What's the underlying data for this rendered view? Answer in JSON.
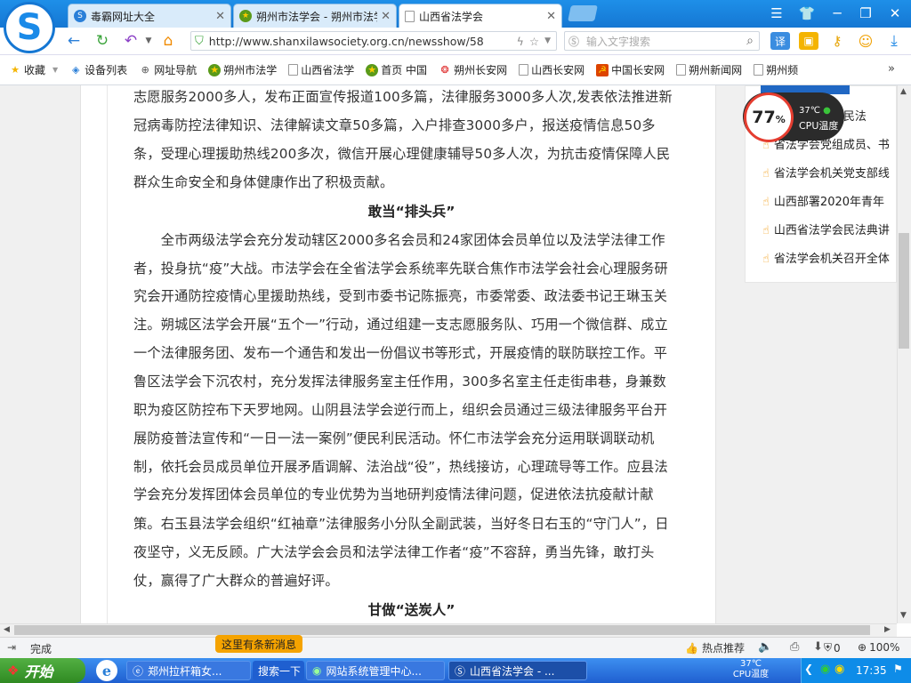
{
  "browser": {
    "tabs": [
      {
        "label": "毒霸网址大全",
        "fav_color": "#2a7fd8"
      },
      {
        "label": "朔州市法学会 - 朔州市法学",
        "fav_color": "#5a9a1a"
      },
      {
        "label": "山西省法学会",
        "fav_color": "#ffffff"
      }
    ],
    "url": "http://www.shanxilawsociety.org.cn/newsshow/58",
    "search_placeholder": "输入文字搜索"
  },
  "bookmarks": [
    {
      "label": "收藏",
      "icon": "star-icon"
    },
    {
      "label": "设备列表",
      "icon": "device-icon"
    },
    {
      "label": "网址导航",
      "icon": "globe-icon"
    },
    {
      "label": "朔州市法学",
      "icon": "emblem-icon"
    },
    {
      "label": "山西省法学",
      "icon": "page-icon"
    },
    {
      "label": "首页 中国",
      "icon": "emblem-icon"
    },
    {
      "label": "朔州长安网",
      "icon": "red-logo-icon"
    },
    {
      "label": "山西长安网",
      "icon": "page-icon"
    },
    {
      "label": "中国长安网",
      "icon": "party-icon"
    },
    {
      "label": "朔州新闻网",
      "icon": "page-icon"
    },
    {
      "label": "朔州频",
      "icon": "page-icon"
    }
  ],
  "article": {
    "lines_top": [
      "志愿服务2000多人，发布正面宣传报道100多篇，法律服务3000多人次,发表依法推进新",
      "冠病毒防控法律知识、法律解读文章50多篇，入户排查3000多户，报送疫情信息50多",
      "条，受理心理援助热线200多次，微信开展心理健康辅导50多人次，为抗击疫情保障人民",
      "群众生命安全和身体健康作出了积极贡献。"
    ],
    "heading1": "敢当“排头兵”",
    "lines_mid": [
      "　　全市两级法学会充分发动辖区2000多名会员和24家团体会员单位以及法学法律工作",
      "者，投身抗“疫”大战。市法学会在全省法学会系统率先联合焦作市法学会社会心理服务研",
      "究会开通防控疫情心里援助热线，受到市委书记陈振亮，市委常委、政法委书记王琳玉关",
      "注。朔城区法学会开展“五个一”行动，通过组建一支志愿服务队、巧用一个微信群、成立",
      "一个法律服务团、发布一个通告和发出一份倡议书等形式，开展疫情的联防联控工作。平",
      "鲁区法学会下沉农村，充分发挥法律服务室主任作用，300多名室主任走街串巷，身兼数",
      "职为疫区防控布下天罗地网。山阴县法学会逆行而上，组织会员通过三级法律服务平台开",
      "展防疫普法宣传和“一日一法一案例”便民利民活动。怀仁市法学会充分运用联调联动机",
      "制，依托会员成员单位开展矛盾调解、法治战“役”，热线接访，心理疏导等工作。应县法",
      "学会充分发挥团体会员单位的专业优势为当地研判疫情法律问题，促进依法抗疫献计献",
      "策。右玉县法学会组织“红袖章”法律服务小分队全副武装，当好冬日右玉的“守门人”，日",
      "夜坚守，义无反顾。广大法学会会员和法学法律工作者“疫”不容辞，勇当先锋，敢打头",
      "仗，赢得了广大群众的普遍好评。"
    ],
    "heading2": "甘做“送炭人”"
  },
  "sidebar": {
    "items": [
      "省法学会组织民法",
      "省法学会党组成员、书",
      "省法学会机关党支部线",
      "山西部署2020年青年",
      "山西省法学会民法典讲",
      "省法学会机关召开全体"
    ]
  },
  "cpu_widget": {
    "percent": "77",
    "unit": "%",
    "temp": "37℃",
    "label": "CPU温度"
  },
  "statusbar": {
    "status": "完成",
    "new_msg": "这里有条新消息",
    "hot": "热点推荐",
    "count": "0",
    "zoom": "100%"
  },
  "taskbar": {
    "start": "开始",
    "items": [
      "郑州拉杆箱女...",
      "搜索一下",
      "网站系统管理中心...",
      "山西省法学会 - ..."
    ],
    "tray_temp": "37℃",
    "tray_label": "CPU温度",
    "time": "17:35"
  }
}
